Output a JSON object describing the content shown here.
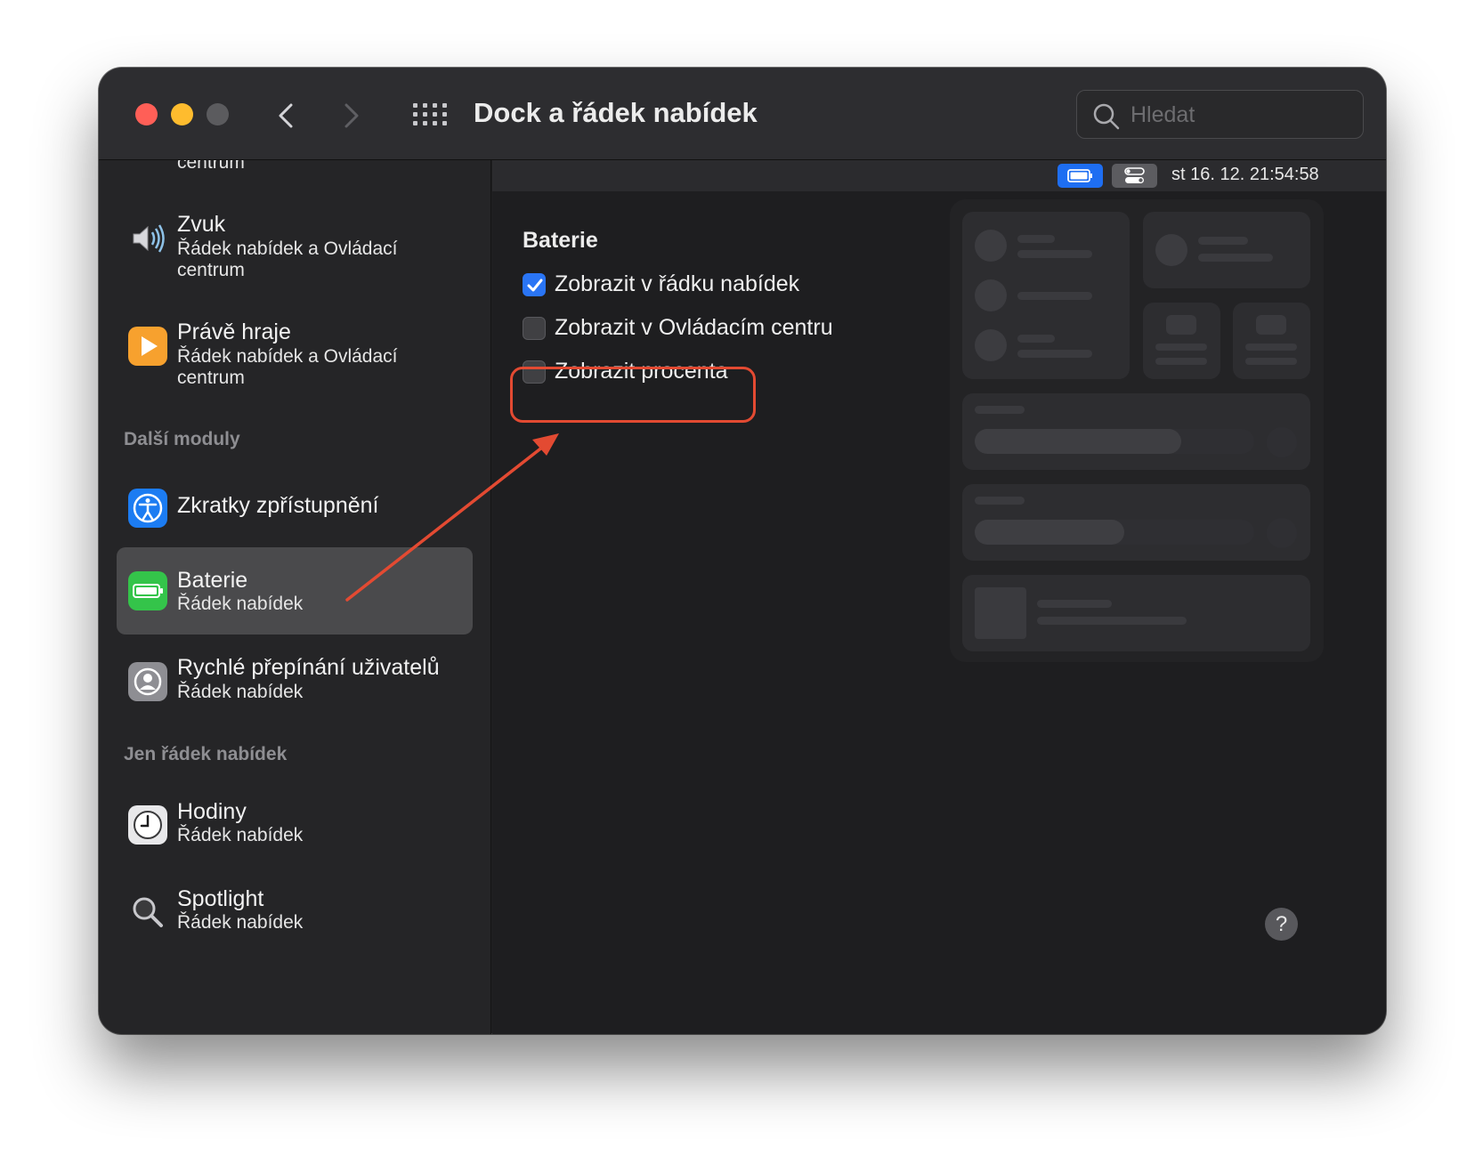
{
  "window": {
    "title": "Dock a řádek nabídek"
  },
  "search": {
    "placeholder": "Hledat"
  },
  "sidebar": {
    "top_cut_label": "centrum",
    "items": [
      {
        "title": "Zvuk",
        "subtitle": "Řádek nabídek a Ovládací centrum",
        "icon": "speaker-icon"
      },
      {
        "title": "Právě hraje",
        "subtitle": "Řádek nabídek a Ovládací centrum",
        "icon": "play-icon"
      },
      {
        "title": "Zkratky zpřístupnění",
        "subtitle": "",
        "icon": "accessibility-icon"
      },
      {
        "title": "Baterie",
        "subtitle": "Řádek nabídek",
        "icon": "battery-icon",
        "selected": true
      },
      {
        "title": "Rychlé přepínání uživatelů",
        "subtitle": "Řádek nabídek",
        "icon": "user-icon"
      },
      {
        "title": "Hodiny",
        "subtitle": "Řádek nabídek",
        "icon": "clock-icon"
      },
      {
        "title": "Spotlight",
        "subtitle": "Řádek nabídek",
        "icon": "spotlight-icon"
      }
    ],
    "sections": {
      "other_modules": "Další moduly",
      "menubar_only": "Jen řádek nabídek"
    }
  },
  "menubar_preview": {
    "clock": "st 16. 12.  21:54:58"
  },
  "battery_settings": {
    "title": "Baterie",
    "options": [
      {
        "label": "Zobrazit v řádku nabídek",
        "checked": true
      },
      {
        "label": "Zobrazit v Ovládacím centru",
        "checked": false
      },
      {
        "label": "Zobrazit procenta",
        "checked": false
      }
    ]
  },
  "help": {
    "label": "?"
  },
  "colors": {
    "accent": "#2a75f5",
    "annotation": "#e34a32",
    "close": "#ff5f57",
    "minimize": "#febc2e"
  }
}
